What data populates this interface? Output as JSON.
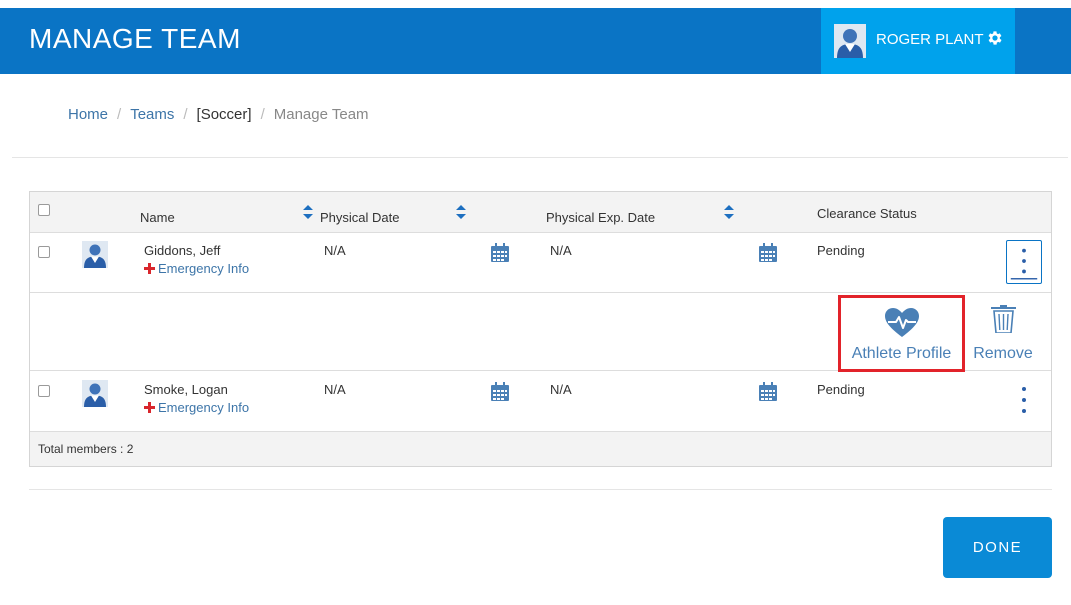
{
  "header": {
    "title": "MANAGE TEAM",
    "user_name": "ROGER PLANT"
  },
  "breadcrumb": {
    "home": "Home",
    "teams": "Teams",
    "team": "[Soccer]",
    "current": "Manage Team"
  },
  "table": {
    "columns": {
      "name": "Name",
      "physical_date": "Physical Date",
      "physical_exp_date": "Physical Exp. Date",
      "clearance_status": "Clearance Status"
    },
    "rows": [
      {
        "name": "Giddons,  Jeff",
        "emergency": "Emergency Info",
        "physical_date": "N/A",
        "physical_exp_date": "N/A",
        "clearance_status": "Pending"
      },
      {
        "name": "Smoke,  Logan",
        "emergency": "Emergency Info",
        "physical_date": "N/A",
        "physical_exp_date": "N/A",
        "clearance_status": "Pending"
      }
    ],
    "actions": {
      "athlete_profile": "Athlete Profile",
      "remove": "Remove"
    },
    "total": "Total members : 2"
  },
  "done_label": "DONE",
  "colors": {
    "header_bg": "#0a74c5",
    "user_box_bg": "#00a2ec",
    "link": "#3d75a8",
    "icon_blue": "#4a80b6",
    "highlight": "#e2232a",
    "done_bg": "#0a8ad6"
  }
}
